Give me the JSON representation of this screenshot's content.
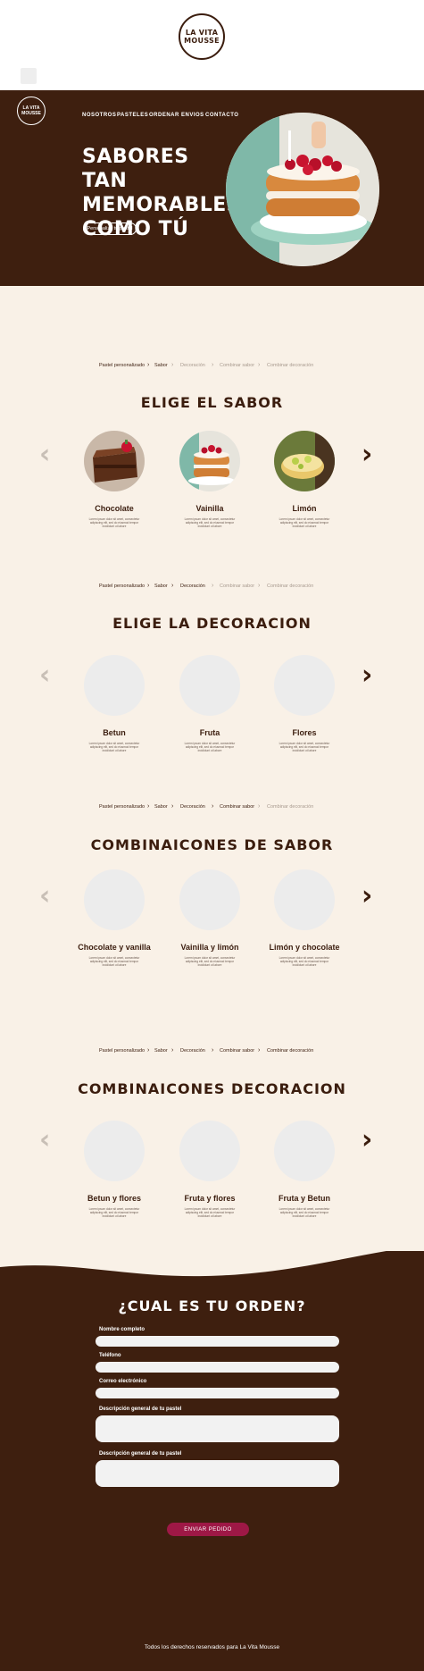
{
  "brand": {
    "logo_line1": "LA VITA",
    "logo_line2": "MOUSSE"
  },
  "nav": {
    "items": [
      "NOSOTROS",
      "PASTELES",
      "ORDENAR",
      "ENVIOS",
      "CONTACTO"
    ]
  },
  "hero": {
    "title": "SABORES TAN MEMORABLES COMO TÚ",
    "button_label": "Personaliza tu pastel"
  },
  "breadcrumb": [
    "Pastel personalizado",
    "Sabor",
    "Decoración",
    "Combinar sabor",
    "Combinar decoración"
  ],
  "sections": [
    {
      "title": "ELIGE EL SABOR",
      "active_steps": 2,
      "cards": [
        {
          "title": "Chocolate",
          "desc": "Lorem ipsum dolor sit amet, consectetur adipiscing elit, sed do eiusmod tempor incididunt ut labore"
        },
        {
          "title": "Vainilla",
          "desc": "Lorem ipsum dolor sit amet, consectetur adipiscing elit, sed do eiusmod tempor incididunt ut labore"
        },
        {
          "title": "Limón",
          "desc": "Lorem ipsum dolor sit amet, consectetur adipiscing elit, sed do eiusmod tempor incididunt ut labore"
        }
      ]
    },
    {
      "title": "ELIGE LA DECORACION",
      "active_steps": 3,
      "cards": [
        {
          "title": "Betun",
          "desc": "Lorem ipsum dolor sit amet, consectetur adipiscing elit, sed do eiusmod tempor incididunt ut labore"
        },
        {
          "title": "Fruta",
          "desc": "Lorem ipsum dolor sit amet, consectetur adipiscing elit, sed do eiusmod tempor incididunt ut labore"
        },
        {
          "title": "Flores",
          "desc": "Lorem ipsum dolor sit amet, consectetur adipiscing elit, sed do eiusmod tempor incididunt ut labore"
        }
      ]
    },
    {
      "title": "COMBINAICONES DE SABOR",
      "active_steps": 4,
      "cards": [
        {
          "title": "Chocolate y vanilla",
          "desc": "Lorem ipsum dolor sit amet, consectetur adipiscing elit, sed do eiusmod tempor incididunt ut labore"
        },
        {
          "title": "Vainilla y limón",
          "desc": "Lorem ipsum dolor sit amet, consectetur adipiscing elit, sed do eiusmod tempor incididunt ut labore"
        },
        {
          "title": "Limón y chocolate",
          "desc": "Lorem ipsum dolor sit amet, consectetur adipiscing elit, sed do eiusmod tempor incididunt ut labore"
        }
      ]
    },
    {
      "title": "COMBINAICONES DECORACION",
      "active_steps": 5,
      "cards": [
        {
          "title": "Betun y flores",
          "desc": "Lorem ipsum dolor sit amet, consectetur adipiscing elit, sed do eiusmod tempor incididunt ut labore"
        },
        {
          "title": "Fruta y flores",
          "desc": "Lorem ipsum dolor sit amet, consectetur adipiscing elit, sed do eiusmod tempor incididunt ut labore"
        },
        {
          "title": "Fruta y Betun",
          "desc": "Lorem ipsum dolor sit amet, consectetur adipiscing elit, sed do eiusmod tempor incididunt ut labore"
        }
      ]
    }
  ],
  "order": {
    "title": "¿CUAL ES TU ORDEN?",
    "fields": [
      {
        "label": "Nombre completo"
      },
      {
        "label": "Teléfono"
      },
      {
        "label": "Correo electrónico"
      },
      {
        "label": "Descripción general de tu pastel"
      },
      {
        "label": "Descripción general de tu pastel"
      }
    ],
    "submit_label": "ENVIAR PEDIDO"
  },
  "footer": {
    "text": "Todos los derechos reservados para La Vita Mousse"
  },
  "colors": {
    "brown": "#3e1f0f",
    "cream": "#f9f1e7",
    "accent": "#9e1846"
  }
}
